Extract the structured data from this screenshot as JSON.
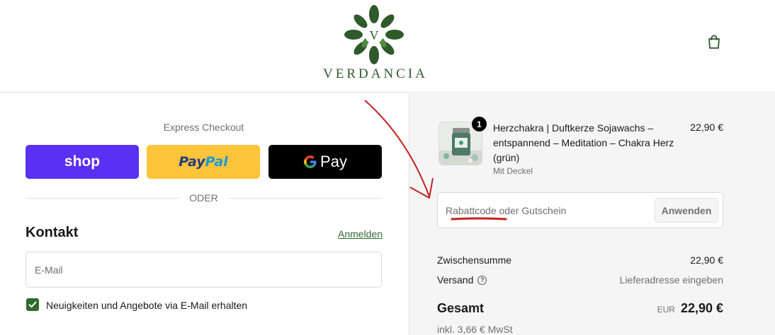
{
  "brand": {
    "name": "VERDANCIA",
    "logo_monogram": "V",
    "primary_color": "#2f5a2c",
    "logo_icon": "leaf-mandala-logo"
  },
  "header": {
    "cart_icon": "shopping-bag-icon"
  },
  "express": {
    "title": "Express Checkout",
    "buttons": {
      "shop": "shop",
      "paypal_1": "Pay",
      "paypal_2": "Pal",
      "gpay": "Pay"
    },
    "divider": "ODER"
  },
  "contact": {
    "heading": "Kontakt",
    "login_link": "Anmelden",
    "email_placeholder": "E-Mail",
    "newsletter_label": "Neuigkeiten und Angebote via E-Mail erhalten",
    "newsletter_checked": true
  },
  "summary": {
    "product": {
      "quantity": "1",
      "title": "Herzchakra | Duftkerze Sojawachs – entspannend – Meditation – Chakra Herz (grün)",
      "variant": "Mit Deckel",
      "price": "22,90 €"
    },
    "discount": {
      "placeholder": "Rabattcode oder Gutschein",
      "apply_label": "Anwenden"
    },
    "subtotal_label": "Zwischensumme",
    "subtotal_value": "22,90 €",
    "shipping_label": "Versand",
    "shipping_value": "Lieferadresse eingeben",
    "total_label": "Gesamt",
    "currency": "EUR",
    "total_value": "22,90 €",
    "tax_note": "inkl. 3,66 € MwSt"
  },
  "colors": {
    "shop": "#5a31f4",
    "paypal": "#ffc439",
    "gpay": "#000000",
    "accent": "#2f6b2c",
    "annotation": "#c62020"
  }
}
